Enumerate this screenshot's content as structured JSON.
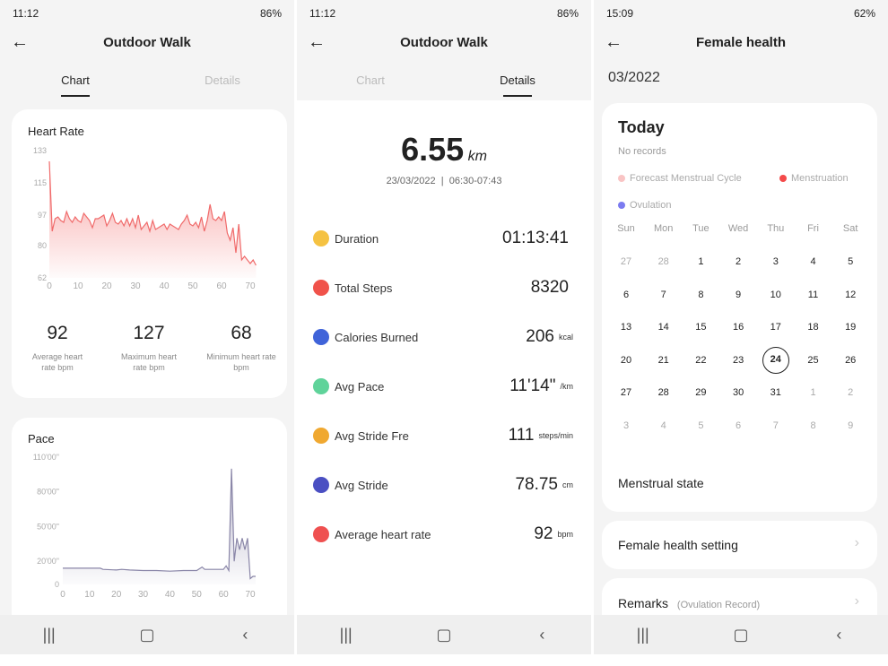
{
  "screen1": {
    "status": {
      "time": "11:12",
      "battery": "86%"
    },
    "title": "Outdoor Walk",
    "tabs": [
      "Chart",
      "Details"
    ],
    "heart": {
      "title": "Heart Rate",
      "stats": [
        {
          "value": "92",
          "label": "Average heart rate bpm"
        },
        {
          "value": "127",
          "label": "Maximum heart rate bpm"
        },
        {
          "value": "68",
          "label": "Minimum heart rate bpm"
        }
      ]
    },
    "pace": {
      "title": "Pace"
    }
  },
  "screen2": {
    "status": {
      "time": "11:12",
      "battery": "86%"
    },
    "title": "Outdoor Walk",
    "tabs": [
      "Chart",
      "Details"
    ],
    "distance": "6.55",
    "distance_unit": "km",
    "date": "23/03/2022",
    "time_range": "06:30-07:43",
    "rows": [
      {
        "label": "Duration",
        "value": "01:13:41",
        "unit": "",
        "icon": "clock-icon",
        "color": "#f5c242"
      },
      {
        "label": "Total Steps",
        "value": "8320",
        "unit": "",
        "icon": "flame-icon",
        "color": "#f0524a"
      },
      {
        "label": "Calories Burned",
        "value": "206",
        "unit": "kcal",
        "icon": "calories-icon",
        "color": "#3f63d9"
      },
      {
        "label": "Avg Pace",
        "value": "11'14\"",
        "unit": "/km",
        "icon": "shoe-icon",
        "color": "#5fd39a"
      },
      {
        "label": "Avg Stride Fre",
        "value": "111",
        "unit": "steps/min",
        "icon": "stride-frequency-icon",
        "color": "#f0a830"
      },
      {
        "label": "Avg Stride",
        "value": "78.75",
        "unit": "cm",
        "icon": "footprint-icon",
        "color": "#4a4fc2"
      },
      {
        "label": "Average heart rate",
        "value": "92",
        "unit": "bpm",
        "icon": "heart-icon",
        "color": "#ef5050"
      }
    ]
  },
  "screen3": {
    "status": {
      "time": "15:09",
      "battery": "62%"
    },
    "title": "Female health",
    "month": "03/2022",
    "today": "Today",
    "no_records": "No records",
    "legend": [
      {
        "label": "Forecast Menstrual Cycle",
        "color": "#f9c4c4"
      },
      {
        "label": "Menstruation",
        "color": "#f44a4a"
      },
      {
        "label": "Ovulation",
        "color": "#7b7bf0"
      }
    ],
    "weekdays": [
      "Sun",
      "Mon",
      "Tue",
      "Wed",
      "Thu",
      "Fri",
      "Sat"
    ],
    "days": [
      [
        "27",
        "28",
        "1",
        "2",
        "3",
        "4",
        "5"
      ],
      [
        "6",
        "7",
        "8",
        "9",
        "10",
        "11",
        "12"
      ],
      [
        "13",
        "14",
        "15",
        "16",
        "17",
        "18",
        "19"
      ],
      [
        "20",
        "21",
        "22",
        "23",
        "24",
        "25",
        "26"
      ],
      [
        "27",
        "28",
        "29",
        "30",
        "31",
        "1",
        "2"
      ],
      [
        "3",
        "4",
        "5",
        "6",
        "7",
        "8",
        "9"
      ]
    ],
    "selected_day": "24",
    "menstrual_state": "Menstrual state",
    "setting": "Female health setting",
    "remarks": "Remarks",
    "remarks_sub": "(Ovulation Record)"
  },
  "chart_data": [
    {
      "type": "area",
      "title": "Heart Rate",
      "ylim": [
        62,
        133
      ],
      "yticks": [
        "133",
        "115",
        "97",
        "80",
        "62"
      ],
      "xlim": [
        0,
        72
      ],
      "xticks": [
        "0",
        "10",
        "20",
        "30",
        "40",
        "50",
        "60",
        "70"
      ],
      "line_color": "#f06a6a",
      "x": [
        0,
        1,
        2,
        3,
        4,
        5,
        6,
        7,
        8,
        9,
        10,
        11,
        12,
        13,
        14,
        15,
        16,
        17,
        18,
        19,
        20,
        21,
        22,
        23,
        24,
        25,
        26,
        27,
        28,
        29,
        30,
        31,
        32,
        33,
        34,
        35,
        36,
        37,
        38,
        39,
        40,
        41,
        42,
        43,
        44,
        45,
        46,
        47,
        48,
        49,
        50,
        51,
        52,
        53,
        54,
        55,
        56,
        57,
        58,
        59,
        60,
        61,
        62,
        63,
        64,
        65,
        66,
        67,
        68,
        69,
        70,
        71,
        72
      ],
      "y": [
        127,
        88,
        95,
        96,
        94,
        93,
        99,
        95,
        93,
        96,
        94,
        93,
        98,
        96,
        94,
        90,
        95,
        95,
        96,
        97,
        91,
        94,
        98,
        93,
        92,
        94,
        91,
        95,
        91,
        95,
        90,
        97,
        89,
        91,
        93,
        88,
        94,
        89,
        90,
        91,
        92,
        89,
        92,
        91,
        90,
        89,
        92,
        94,
        97,
        92,
        91,
        93,
        90,
        96,
        88,
        94,
        103,
        95,
        94,
        96,
        94,
        99,
        87,
        83,
        90,
        76,
        92,
        72,
        74,
        72,
        70,
        72,
        69
      ]
    },
    {
      "type": "area",
      "title": "Pace",
      "ylim": [
        0,
        110
      ],
      "yticks": [
        "110'00\"",
        "80'00\"",
        "50'00\"",
        "20'00\"",
        "0"
      ],
      "xlim": [
        0,
        72
      ],
      "xticks": [
        "0",
        "10",
        "20",
        "30",
        "40",
        "50",
        "60",
        "70"
      ],
      "line_color": "#8a86a8",
      "x": [
        0,
        5,
        10,
        14,
        15,
        20,
        22,
        25,
        30,
        35,
        40,
        45,
        50,
        52,
        53,
        55,
        60,
        61,
        62,
        63,
        64,
        65,
        66,
        67,
        68,
        69,
        70,
        71,
        72
      ],
      "y": [
        14,
        14,
        14,
        14,
        13,
        12.5,
        13,
        12.5,
        12,
        12,
        11.5,
        12,
        12,
        15,
        13,
        13,
        13,
        16,
        12,
        100,
        20,
        40,
        30,
        40,
        30,
        40,
        5,
        7,
        7
      ]
    }
  ]
}
